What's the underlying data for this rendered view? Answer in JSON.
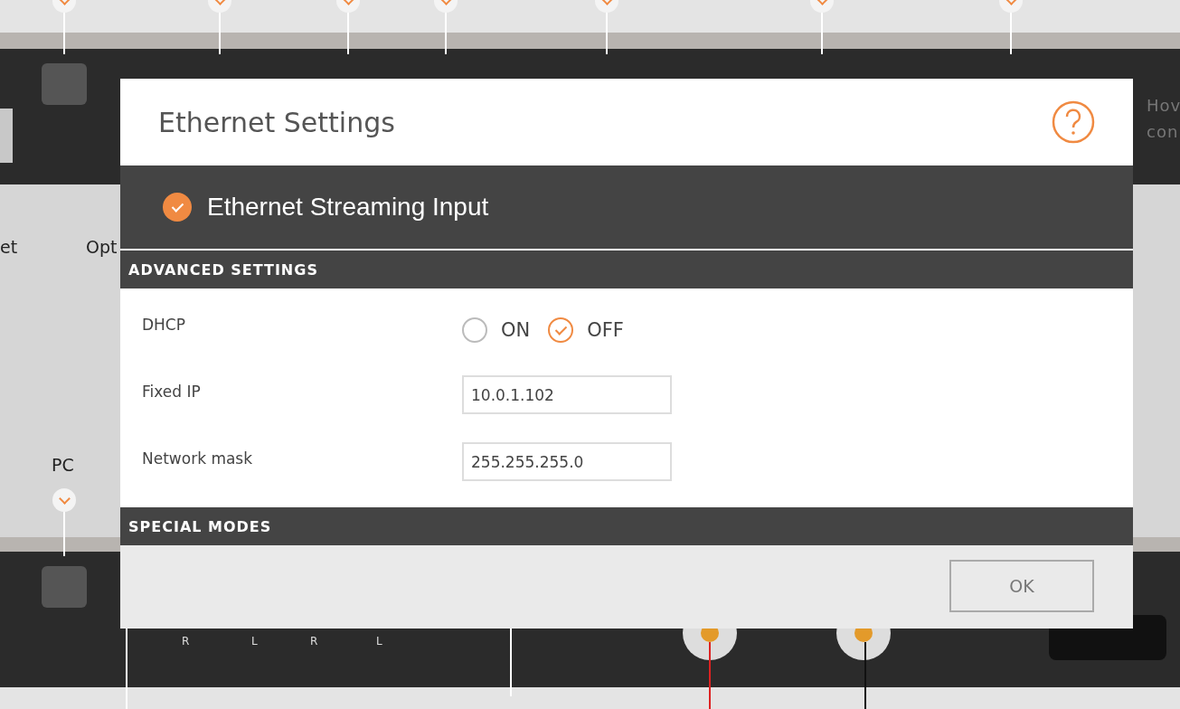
{
  "background": {
    "port_labels": [
      "et",
      "Opt",
      "PC"
    ],
    "channel_labels": [
      "R",
      "L",
      "R",
      "L"
    ],
    "side_text": [
      "Hov",
      "con"
    ]
  },
  "dialog": {
    "title": "Ethernet Settings",
    "input": {
      "label": "Ethernet Streaming Input",
      "checked": true
    },
    "sections": [
      {
        "heading": "ADVANCED SETTINGS",
        "rows": [
          {
            "kind": "radio",
            "label": "DHCP",
            "options": [
              {
                "label": "ON",
                "selected": false
              },
              {
                "label": "OFF",
                "selected": true
              }
            ]
          },
          {
            "kind": "field",
            "label": "Fixed IP",
            "value": "10.0.1.102"
          },
          {
            "kind": "field",
            "label": "Network mask",
            "value": "255.255.255.0"
          }
        ]
      },
      {
        "heading": "SPECIAL MODES"
      }
    ],
    "buttons": [
      "OK"
    ]
  }
}
